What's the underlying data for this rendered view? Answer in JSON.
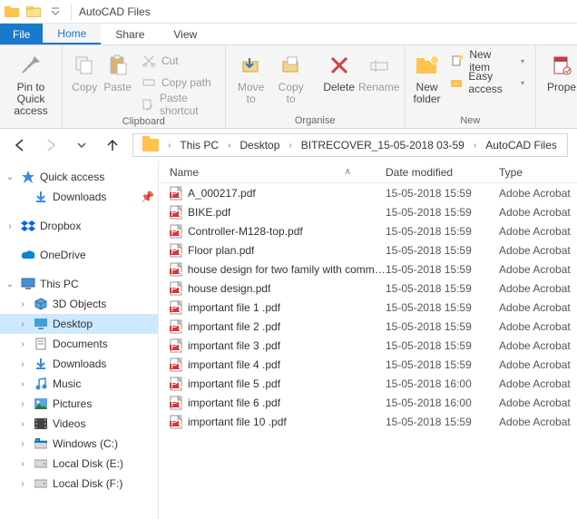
{
  "window": {
    "title": "AutoCAD Files"
  },
  "tabs": {
    "file": "File",
    "home": "Home",
    "share": "Share",
    "view": "View"
  },
  "ribbon": {
    "pin": "Pin to Quick\naccess",
    "copy": "Copy",
    "paste": "Paste",
    "cut": "Cut",
    "copypath": "Copy path",
    "pasteshort": "Paste shortcut",
    "clipboard_group": "Clipboard",
    "moveto": "Move\nto",
    "copyto": "Copy\nto",
    "delete": "Delete",
    "rename": "Rename",
    "organise_group": "Organise",
    "newfolder": "New\nfolder",
    "newitem": "New item",
    "easyaccess": "Easy access",
    "new_group": "New",
    "properties": "Prope"
  },
  "breadcrumb": {
    "items": [
      "This PC",
      "Desktop",
      "BITRECOVER_15-05-2018 03-59",
      "AutoCAD Files"
    ]
  },
  "tree": {
    "quickaccess": "Quick access",
    "downloads": "Downloads",
    "dropbox": "Dropbox",
    "onedrive": "OneDrive",
    "thispc": "This PC",
    "threed": "3D Objects",
    "desktop": "Desktop",
    "documents": "Documents",
    "downloads2": "Downloads",
    "music": "Music",
    "pictures": "Pictures",
    "videos": "Videos",
    "windowsc": "Windows (C:)",
    "locale": "Local Disk (E:)",
    "localf": "Local Disk (F:)"
  },
  "columns": {
    "name": "Name",
    "date": "Date modified",
    "type": "Type"
  },
  "files": [
    {
      "name": "A_000217.pdf",
      "date": "15-05-2018 15:59",
      "type": "Adobe Acrobat"
    },
    {
      "name": "BIKE.pdf",
      "date": "15-05-2018 15:59",
      "type": "Adobe Acrobat"
    },
    {
      "name": "Controller-M128-top.pdf",
      "date": "15-05-2018 15:59",
      "type": "Adobe Acrobat"
    },
    {
      "name": "Floor plan.pdf",
      "date": "15-05-2018 15:59",
      "type": "Adobe Acrobat"
    },
    {
      "name": "house design for two family with comma...",
      "date": "15-05-2018 15:59",
      "type": "Adobe Acrobat"
    },
    {
      "name": "house design.pdf",
      "date": "15-05-2018 15:59",
      "type": "Adobe Acrobat"
    },
    {
      "name": "important file 1 .pdf",
      "date": "15-05-2018 15:59",
      "type": "Adobe Acrobat"
    },
    {
      "name": "important file 2 .pdf",
      "date": "15-05-2018 15:59",
      "type": "Adobe Acrobat"
    },
    {
      "name": "important file 3 .pdf",
      "date": "15-05-2018 15:59",
      "type": "Adobe Acrobat"
    },
    {
      "name": "important file 4 .pdf",
      "date": "15-05-2018 15:59",
      "type": "Adobe Acrobat"
    },
    {
      "name": "important file 5 .pdf",
      "date": "15-05-2018 16:00",
      "type": "Adobe Acrobat"
    },
    {
      "name": "important file 6 .pdf",
      "date": "15-05-2018 16:00",
      "type": "Adobe Acrobat"
    },
    {
      "name": "important file 10 .pdf",
      "date": "15-05-2018 15:59",
      "type": "Adobe Acrobat"
    }
  ]
}
